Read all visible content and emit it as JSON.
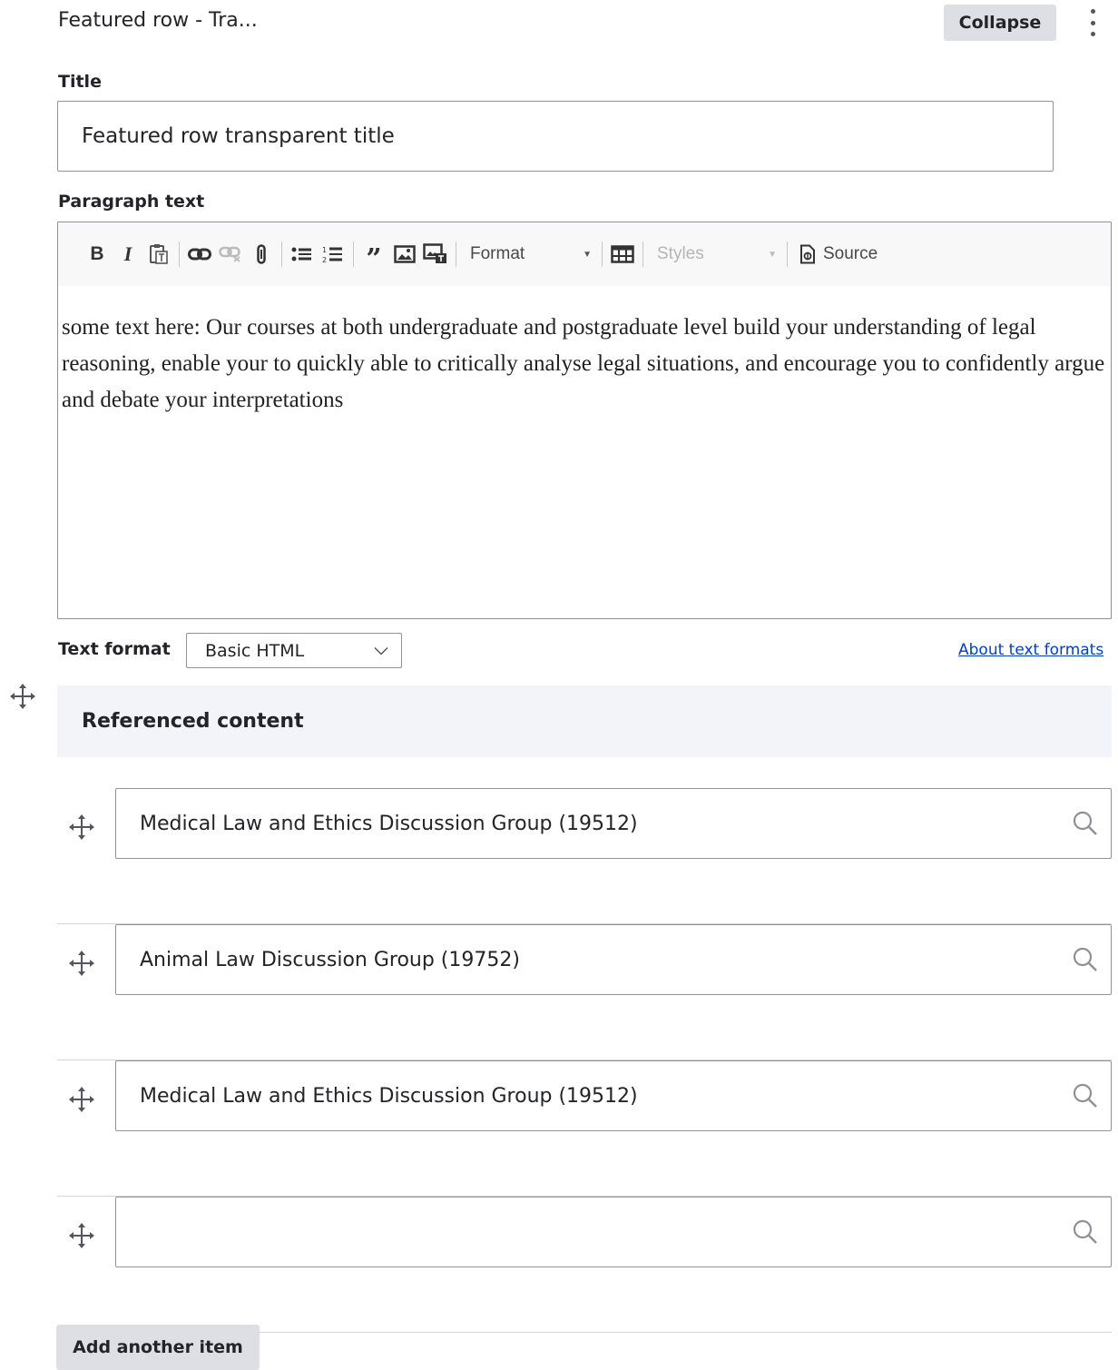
{
  "header": {
    "title": "Featured row - Tra...",
    "collapse_label": "Collapse"
  },
  "title_field": {
    "label": "Title",
    "value": "Featured row transparent title"
  },
  "paragraph_field": {
    "label": "Paragraph text",
    "toolbar": {
      "bold": "B",
      "italic": "I",
      "format_label": "Format",
      "styles_label": "Styles",
      "source_label": "Source"
    },
    "body": "some text here: Our courses at both undergraduate and postgraduate level build your understanding of legal reasoning, enable your to quickly able to critically analyse legal situations, and encourage you to confidently argue and debate your interpretations"
  },
  "text_format": {
    "label": "Text format",
    "selected": "Basic HTML",
    "about_link": "About text formats"
  },
  "referenced_content": {
    "label": "Referenced content",
    "items": [
      {
        "value": "Medical Law and Ethics Discussion Group (19512)"
      },
      {
        "value": "Animal Law Discussion Group (19752)"
      },
      {
        "value": "Medical Law and Ethics Discussion Group (19512)"
      },
      {
        "value": ""
      }
    ],
    "add_label": "Add another item"
  },
  "colors": {
    "link": "#003ecc",
    "button_bg": "#dedfe4",
    "section_bg": "#f3f4f9",
    "border": "#919297"
  },
  "icons": {
    "drag": "move-arrows-icon",
    "search": "magnifier-icon",
    "menu": "vertical-ellipsis-icon"
  }
}
